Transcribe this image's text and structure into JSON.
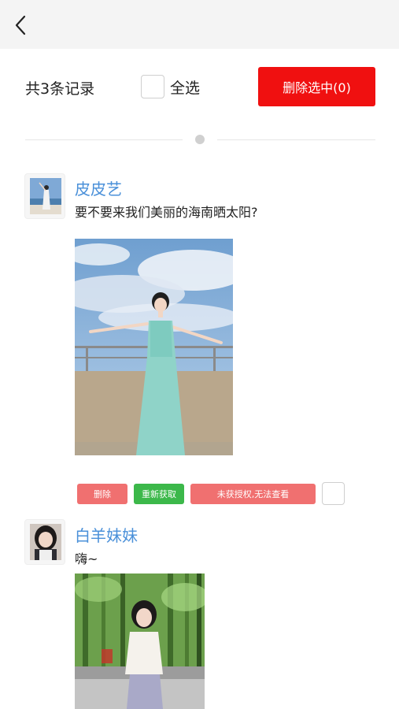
{
  "header": {
    "back_icon": "chevron-left-icon"
  },
  "toolbar": {
    "record_count": "共3条记录",
    "select_all_label": "全选",
    "delete_selected_label": "删除选中(0)",
    "accent_color": "#f01010"
  },
  "posts": [
    {
      "username": "皮皮艺",
      "text": "要不要来我们美丽的海南晒太阳?",
      "actions": {
        "delete": "删除",
        "refetch": "重新获取",
        "unauthorized": "未获授权,无法查看"
      }
    },
    {
      "username": "白羊妹妹",
      "text": "嗨~"
    }
  ],
  "colors": {
    "username": "#4a90d9",
    "delete_action": "#f07070",
    "refetch_action": "#3cb84a"
  }
}
